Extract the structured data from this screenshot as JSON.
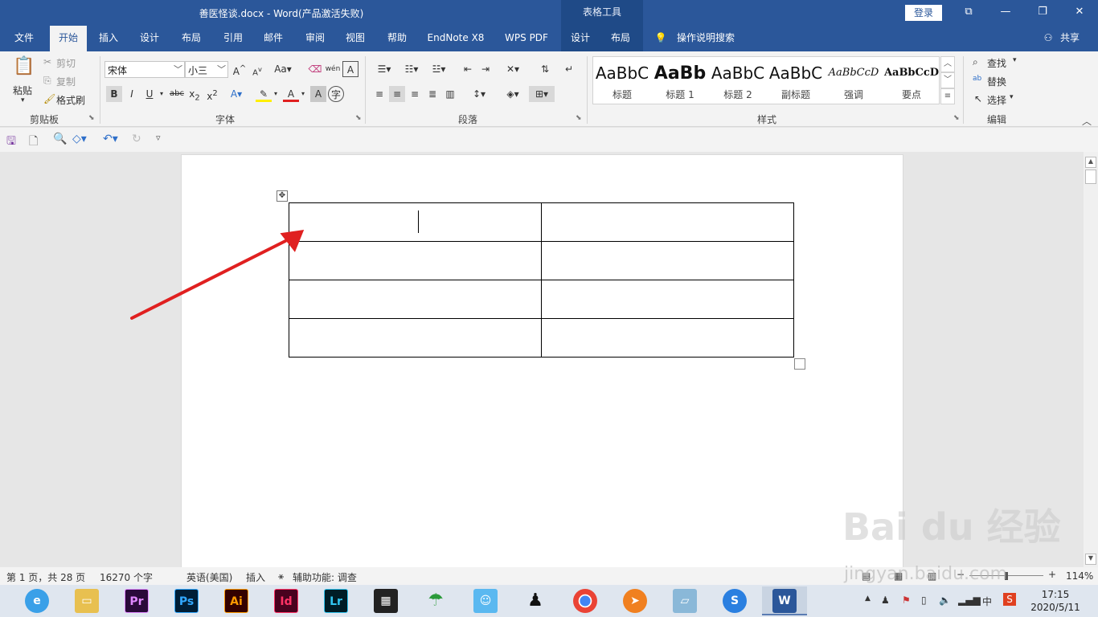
{
  "titlebar": {
    "title": "善医怪谈.docx  -  Word(产品激活失败)",
    "context": "表格工具",
    "login": "登录",
    "restore_ribbon": "⧉",
    "minimize": "—",
    "maximize": "❐",
    "close": "✕"
  },
  "tabs": [
    "文件",
    "开始",
    "插入",
    "设计",
    "布局",
    "引用",
    "邮件",
    "审阅",
    "视图",
    "帮助",
    "EndNote X8",
    "WPS PDF",
    "设计",
    "布局"
  ],
  "tell_me": "操作说明搜索",
  "share": "共享",
  "clipboard": {
    "paste": "粘贴",
    "cut": "剪切",
    "copy": "复制",
    "format_painter": "格式刷",
    "label": "剪贴板"
  },
  "font": {
    "name": "宋体",
    "size": "小三",
    "label": "字体"
  },
  "paragraph": {
    "label": "段落"
  },
  "styles": {
    "items": [
      {
        "sample": "AaBbC",
        "label": "标题"
      },
      {
        "sample": "AaBb",
        "label": "标题 1"
      },
      {
        "sample": "AaBbC",
        "label": "标题 2"
      },
      {
        "sample": "AaBbC",
        "label": "副标题"
      },
      {
        "sample": "AaBbCcD",
        "label": "强调"
      },
      {
        "sample": "AaBbCcD",
        "label": "要点"
      }
    ],
    "label": "样式"
  },
  "editing": {
    "find": "查找",
    "replace": "替换",
    "select": "选择",
    "label": "编辑"
  },
  "status": {
    "page": "第 1 页，共 28 页",
    "words": "16270 个字",
    "lang": "英语(美国)",
    "mode": "插入",
    "accessibility": "辅助功能: 调查",
    "zoom": "114%"
  },
  "taskbar": {
    "apps": [
      {
        "name": "Pr",
        "color": "#2a0a3a"
      },
      {
        "name": "Ps",
        "color": "#001e36"
      },
      {
        "name": "Ai",
        "color": "#330000"
      },
      {
        "name": "Id",
        "color": "#49021f"
      },
      {
        "name": "Lr",
        "color": "#001d26"
      }
    ],
    "time": "17:15",
    "date": "2020/5/11",
    "ime": "中"
  },
  "watermark": {
    "brand": "Bai du 经验",
    "url": "jingyan.baidu.com"
  },
  "colors": {
    "accent": "#2b579a",
    "arrow": "#e02020"
  }
}
